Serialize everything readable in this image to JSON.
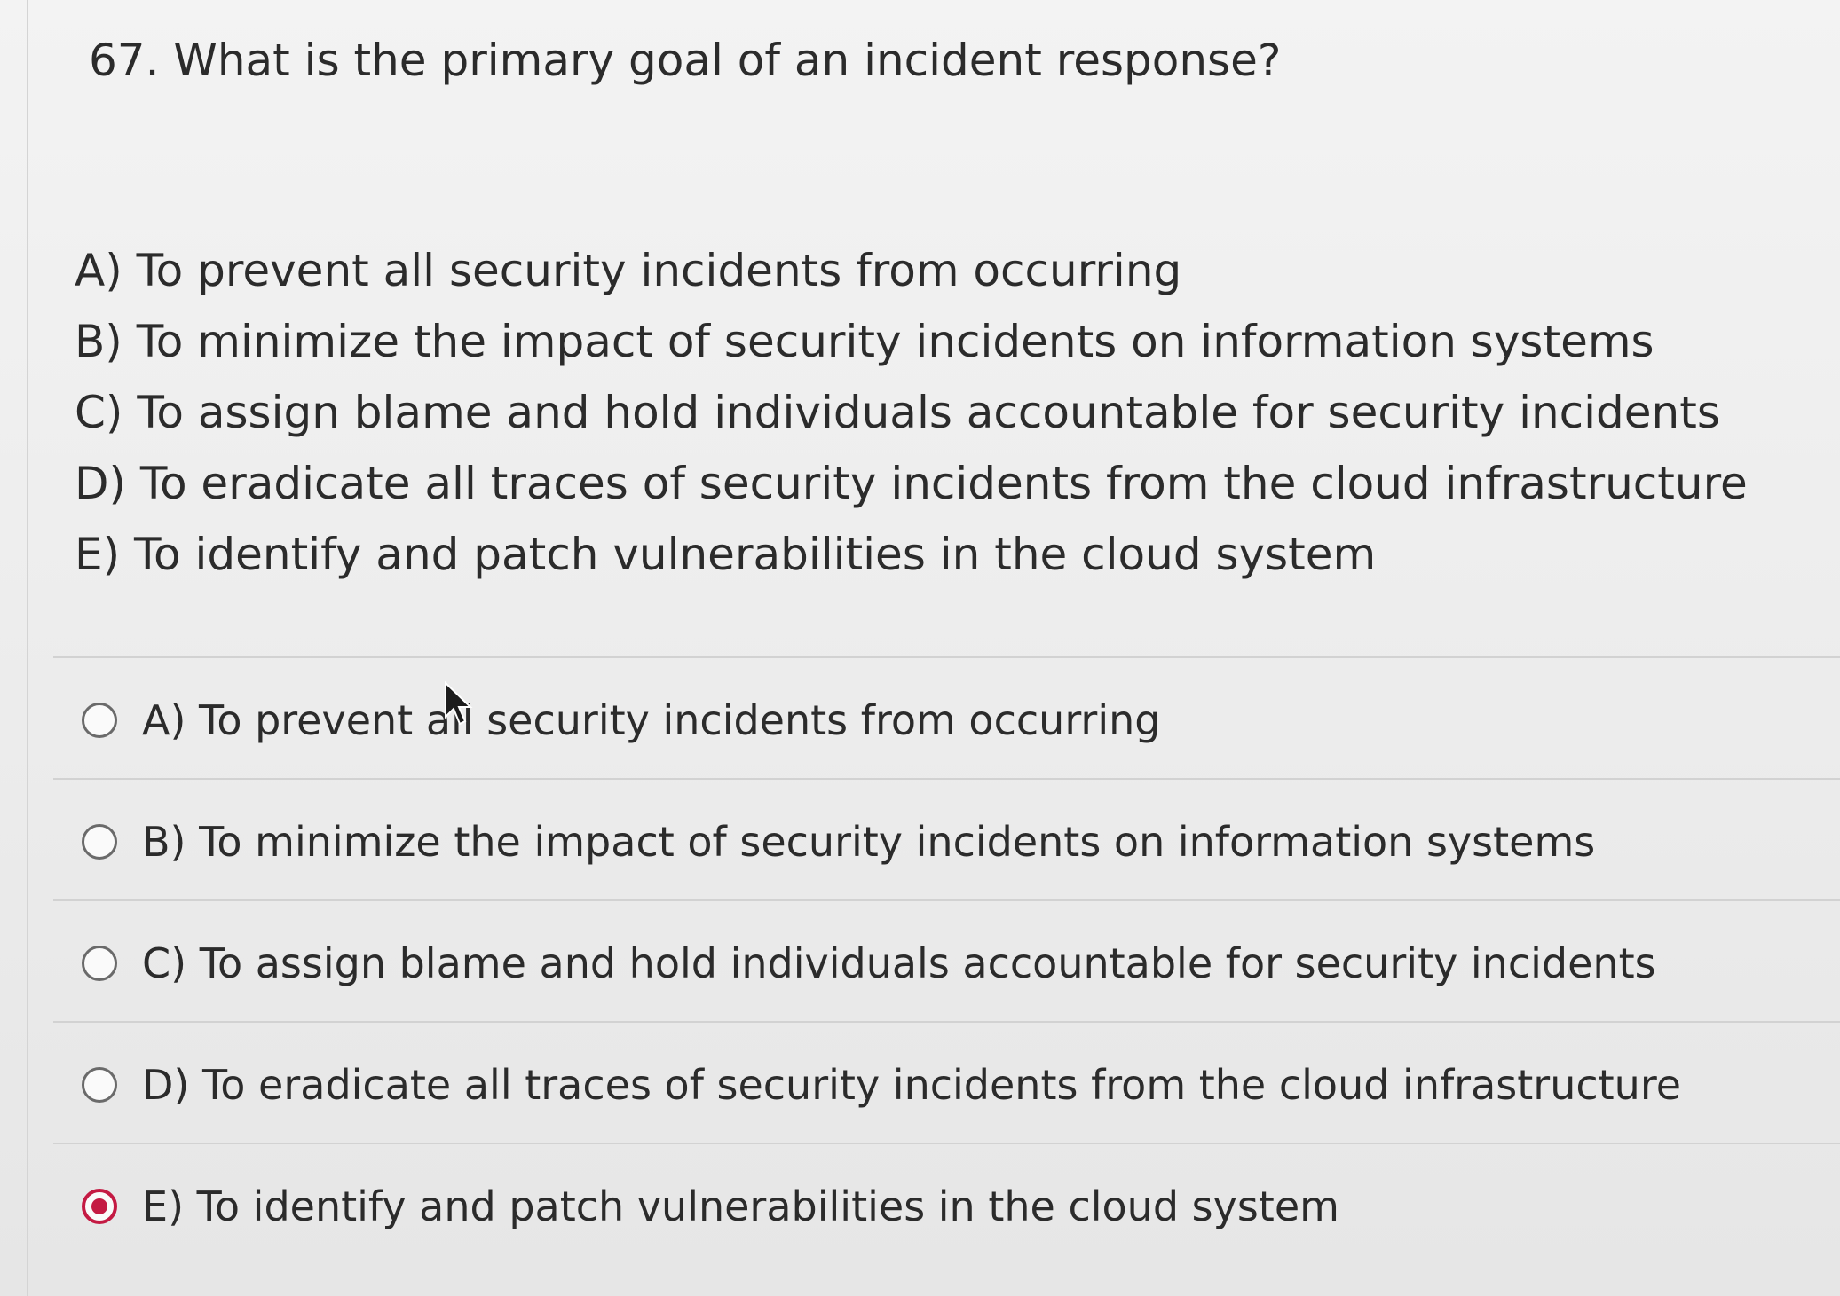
{
  "question": {
    "text": "67. What is the primary goal of an incident response?"
  },
  "choices_text": [
    {
      "text": "A) To prevent all security incidents from occurring"
    },
    {
      "text": "B) To minimize the impact of security incidents on information systems"
    },
    {
      "text": "C) To assign blame and hold individuals accountable for security incidents"
    },
    {
      "text": "D) To eradicate all traces of security incidents from the cloud infrastructure"
    },
    {
      "text": "E) To identify and patch vulnerabilities in the cloud system"
    }
  ],
  "answers": [
    {
      "label": "A) To prevent all security incidents from occurring",
      "selected": false
    },
    {
      "label": "B) To minimize the impact of security incidents on information systems",
      "selected": false
    },
    {
      "label": "C) To assign blame and hold individuals accountable for security incidents",
      "selected": false
    },
    {
      "label": "D) To eradicate all traces of security incidents from the cloud infrastructure",
      "selected": false
    },
    {
      "label": "E) To identify and patch vulnerabilities in the cloud system",
      "selected": true
    }
  ],
  "colors": {
    "selected_radio": "#c41a43",
    "text": "#2b2b2b",
    "divider": "#d2d2d2"
  },
  "icons": {
    "pointer": "mouse-pointer-icon"
  }
}
